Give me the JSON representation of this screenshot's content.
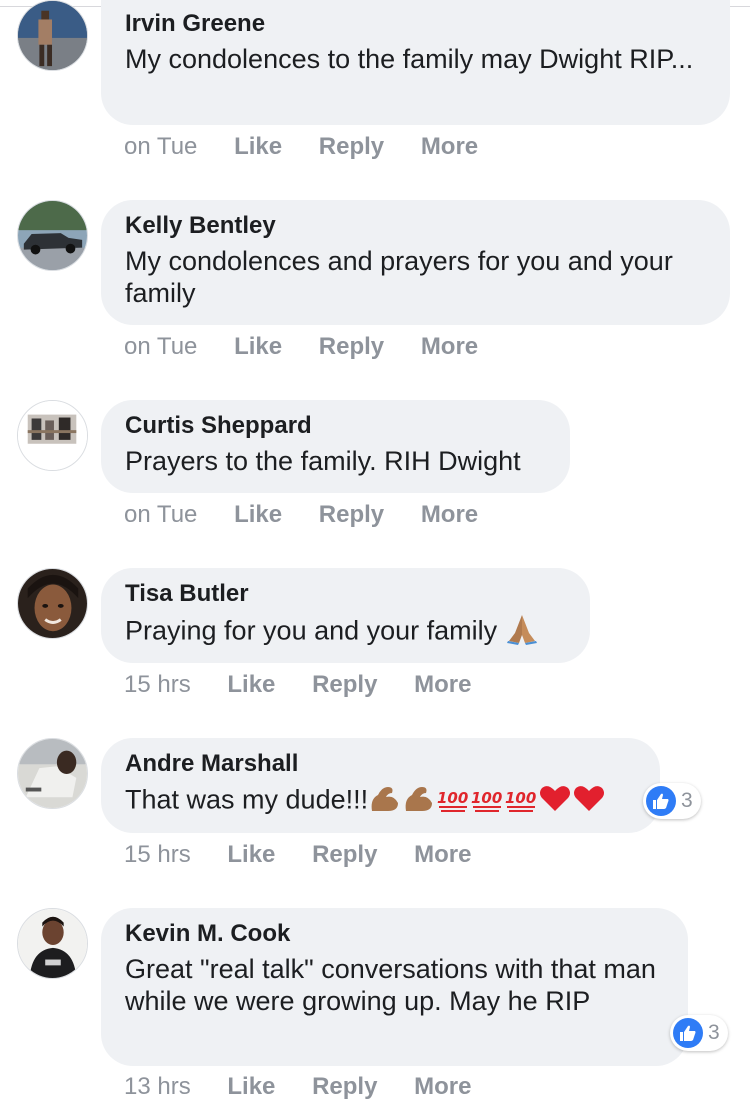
{
  "comments": [
    {
      "name": "Irvin Greene",
      "text": "My condolences to the family may Dwight RIP...",
      "time": "on Tue",
      "like": "Like",
      "reply": "Reply",
      "more": "More"
    },
    {
      "name": "Kelly Bentley",
      "text": "My condolences and prayers for you and your family",
      "time": "on Tue",
      "like": "Like",
      "reply": "Reply",
      "more": "More"
    },
    {
      "name": "Curtis Sheppard",
      "text": "Prayers to the family. RIH Dwight",
      "time": "on Tue",
      "like": "Like",
      "reply": "Reply",
      "more": "More"
    },
    {
      "name": "Tisa Butler",
      "text": "Praying for you and your family",
      "time": "15 hrs",
      "like": "Like",
      "reply": "Reply",
      "more": "More"
    },
    {
      "name": "Andre Marshall",
      "text": "That was my dude!!!",
      "time": "15 hrs",
      "like": "Like",
      "reply": "Reply",
      "more": "More",
      "reaction_count": "3"
    },
    {
      "name": "Kevin M. Cook",
      "text": "Great \"real talk\" conversations with that man while we were growing up. May he RIP",
      "time": "13 hrs",
      "like": "Like",
      "reply": "Reply",
      "more": "More",
      "reaction_count": "3"
    }
  ],
  "colors": {
    "bubble": "#eff1f4",
    "meta": "#8e939b",
    "like_blue": "#2f7cf6",
    "heart": "#e2202e"
  },
  "icons": [
    "praying-hands-icon",
    "flexed-biceps-icon",
    "hundred-points-icon",
    "red-heart-icon",
    "thumbs-up-icon"
  ]
}
